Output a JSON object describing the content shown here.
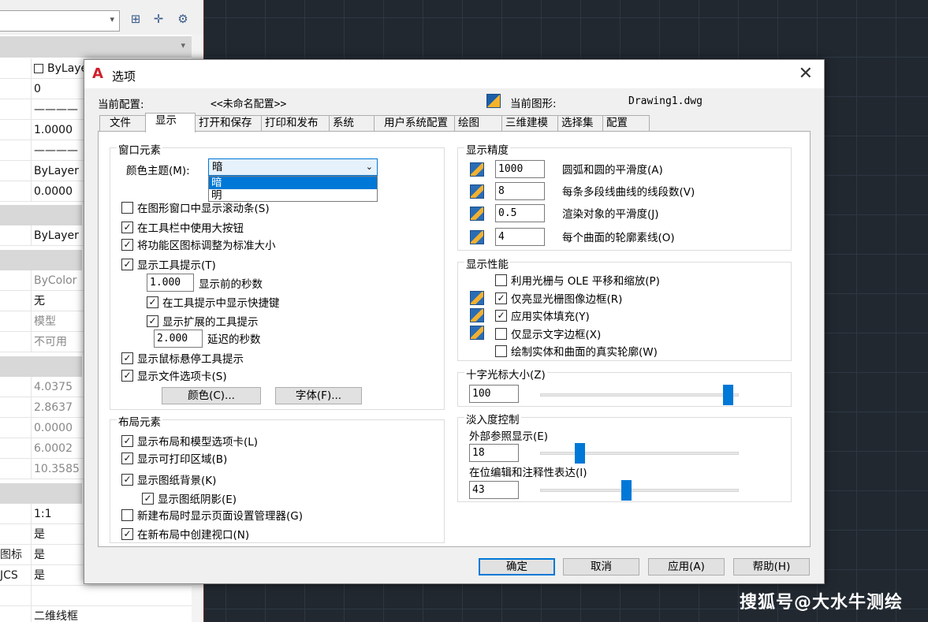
{
  "props_panel": {
    "rows": [
      "ByLayer",
      "0",
      "1.0000",
      "ByLayer",
      "0.0000",
      "ByLayer",
      "ByColor",
      "无",
      "模型",
      "不可用",
      "4.0375",
      "2.8637",
      "0.0000",
      "6.0002",
      "10.3585",
      "1:1",
      "是",
      "是",
      "是",
      "二维线框"
    ],
    "keys": {
      "icon_label": "图标",
      "ucs_label": "JCS"
    }
  },
  "watermark": "搜狐号@大水牛测绘",
  "dialog": {
    "title": "选项",
    "close_label": "✕",
    "profile_label": "当前配置:",
    "profile_value": "<<未命名配置>>",
    "drawing_label": "当前图形:",
    "drawing_value": "Drawing1.dwg",
    "tabs": [
      "文件",
      "显示",
      "打开和保存",
      "打印和发布",
      "系统",
      "用户系统配置",
      "绘图",
      "三维建模",
      "选择集",
      "配置"
    ],
    "window_elements": {
      "title": "窗口元素",
      "color_theme_label": "颜色主题(M):",
      "color_theme_value": "暗",
      "color_theme_options": [
        "暗",
        "明"
      ],
      "chk_scrollbars": "在图形窗口中显示滚动条(S)",
      "chk_large_buttons": "在工具栏中使用大按钮",
      "chk_resize_ribbon": "将功能区图标调整为标准大小",
      "chk_tooltips": "显示工具提示(T)",
      "tooltip_delay_value": "1.000",
      "tooltip_delay_label": "显示前的秒数",
      "chk_shortcut_keys": "在工具提示中显示快捷键",
      "chk_extended_tooltips": "显示扩展的工具提示",
      "extended_delay_value": "2.000",
      "extended_delay_label": "延迟的秒数",
      "chk_rollover": "显示鼠标悬停工具提示",
      "chk_file_tabs": "显示文件选项卡(S)",
      "colors_button": "颜色(C)...",
      "fonts_button": "字体(F)..."
    },
    "layout_elements": {
      "title": "布局元素",
      "chk_layout_tabs": "显示布局和模型选项卡(L)",
      "chk_printable": "显示可打印区域(B)",
      "chk_paper_bg": "显示图纸背景(K)",
      "chk_paper_shadow": "显示图纸阴影(E)",
      "chk_page_setup": "新建布局时显示页面设置管理器(G)",
      "chk_viewport": "在新布局中创建视口(N)"
    },
    "resolution": {
      "title": "显示精度",
      "arc_value": "1000",
      "arc_label": "圆弧和圆的平滑度(A)",
      "pline_value": "8",
      "pline_label": "每条多段线曲线的线段数(V)",
      "render_value": "0.5",
      "render_label": "渲染对象的平滑度(J)",
      "contour_value": "4",
      "contour_label": "每个曲面的轮廓素线(O)"
    },
    "performance": {
      "title": "显示性能",
      "chk_raster_pan": "利用光栅与 OLE 平移和缩放(P)",
      "chk_raster_frame": "仅亮显光栅图像边框(R)",
      "chk_solid_fill": "应用实体填充(Y)",
      "chk_text_frame": "仅显示文字边框(X)",
      "chk_silhouettes": "绘制实体和曲面的真实轮廓(W)"
    },
    "crosshair": {
      "title": "十字光标大小(Z)",
      "value": "100",
      "level": 100
    },
    "fade": {
      "title": "淡入度控制",
      "xref_label": "外部参照显示(E)",
      "xref_value": "18",
      "xref_level": 18,
      "inplace_label": "在位编辑和注释性表达(I)",
      "inplace_value": "43",
      "inplace_level": 43
    },
    "buttons": {
      "ok": "确定",
      "cancel": "取消",
      "apply": "应用(A)",
      "help": "帮助(H)"
    }
  }
}
